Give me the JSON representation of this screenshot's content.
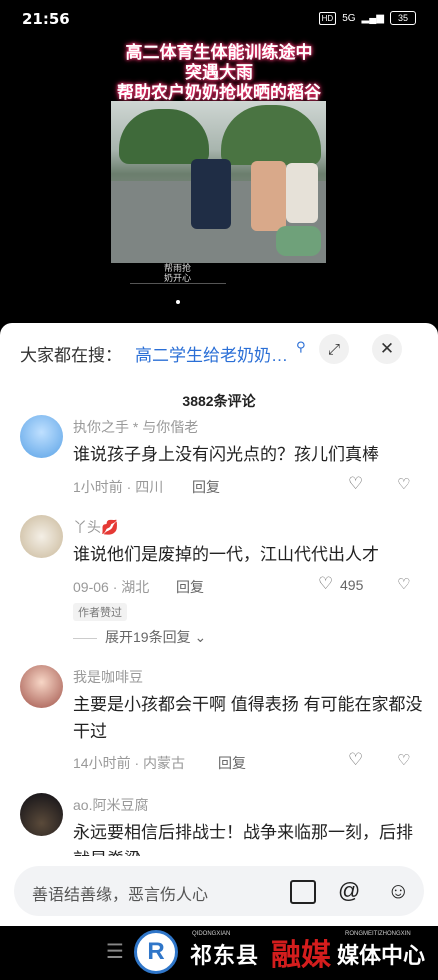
{
  "status_bar": {
    "time": "21:56",
    "hd": "HD",
    "network": "5G",
    "battery": "35"
  },
  "video": {
    "caption_lines": [
      "高二体育生体能训练途中",
      "突遇大雨",
      "帮助农户奶奶抢收晒的稻谷"
    ],
    "watermark": "帮雨抢\n奶开心"
  },
  "search": {
    "prefix": "大家都在搜：",
    "query": "高二学生给老奶奶…",
    "icon": "search-icon"
  },
  "comments_header": {
    "count_label": "3882条评论"
  },
  "comments": [
    {
      "name": "执你之手 * 与你偕老",
      "text": "谁说孩子身上没有闪光点的？孩儿们真棒",
      "meta": "1小时前 · 四川",
      "reply": "回复",
      "likes": ""
    },
    {
      "name": "丫头💋",
      "text": "谁说他们是废掉的一代，江山代代出人才",
      "meta": "09-06 · 湖北",
      "reply": "回复",
      "likes": "495",
      "author_tag": "作者赞过",
      "expand": "展开19条回复"
    },
    {
      "name": "我是咖啡豆",
      "text": "主要是小孩都会干啊 值得表扬   有可能在家都没干过",
      "meta": "14小时前 · 内蒙古",
      "reply": "回复",
      "likes": ""
    },
    {
      "name": "ao.阿米豆腐",
      "text": "永远要相信后排战士！战争来临那一刻，后排就是脊梁",
      "meta": "",
      "reply": "",
      "likes": ""
    }
  ],
  "input": {
    "placeholder": "善语结善缘，恶言伤人心"
  },
  "bottom_brand": {
    "logo_letter": "R",
    "left_text": "祁东县",
    "left_pinyin": "QIDONGXIAN",
    "middle_text": "融媒",
    "right_pinyin": "RONGMEITIZHONGXIN",
    "right_text": "媒体中心"
  }
}
